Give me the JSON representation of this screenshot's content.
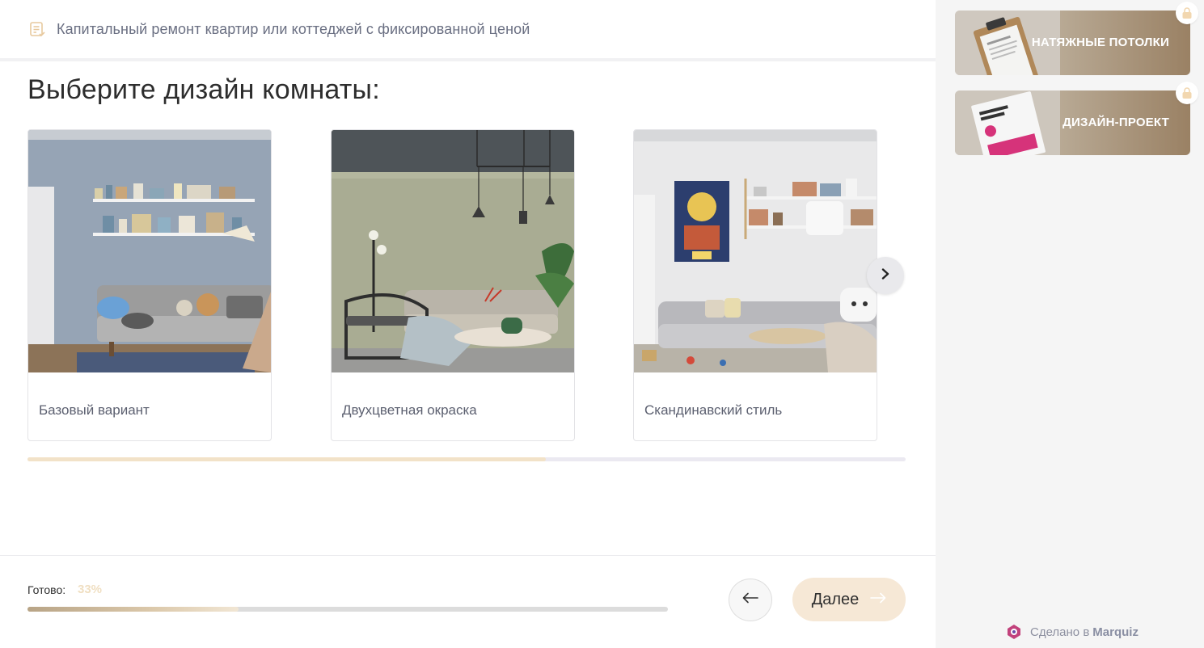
{
  "header": {
    "title": "Капитальный ремонт квартир или коттеджей с фиксированной ценой",
    "icon": "document-icon"
  },
  "question": "Выберите дизайн комнаты:",
  "options": [
    {
      "label": "Базовый вариант",
      "image": "blue-gray-living-room"
    },
    {
      "label": "Двухцветная окраска",
      "image": "two-tone-olive-living-room"
    },
    {
      "label": "Скандинавский стиль",
      "image": "scandinavian-white-living-room"
    }
  ],
  "carousel": {
    "scroll_fraction": 0.59
  },
  "footer": {
    "progress_label": "Готово:",
    "progress_value": "33%",
    "progress_fraction": 0.33,
    "back_icon": "arrow-left-icon",
    "next_label": "Далее",
    "next_icon": "arrow-right-icon"
  },
  "sidebar": {
    "bonuses": [
      {
        "title": "НАТЯЖНЫЕ ПОТОЛКИ",
        "icon": "lock-icon"
      },
      {
        "title": "ДИЗАЙН-ПРОЕКТ",
        "icon": "lock-icon"
      }
    ]
  },
  "branding": {
    "made_with": "Сделано в",
    "brand": "Marquiz"
  },
  "colors": {
    "accent": "#f6e8d6",
    "progress_value": "#f0dfc2",
    "sidebar_bg": "#f5f5f5"
  }
}
